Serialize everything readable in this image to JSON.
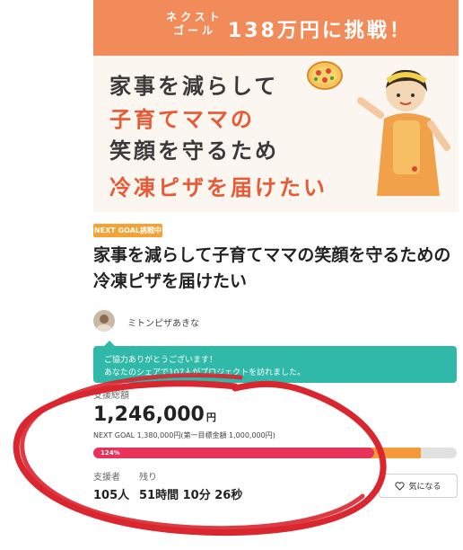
{
  "hero": {
    "next_goal_label": "ネクスト ゴール",
    "goal_text": "138万円に挑戦！",
    "line1": "家事を減らして",
    "line2": "子育てママの",
    "line3": "笑顔を守るため",
    "line4": "冷凍ピザを届けたい"
  },
  "tag": "NEXT GOAL挑戦中",
  "title": "家事を減らして子育てママの笑顔を守るための冷凍ピザを届けたい",
  "owner": {
    "name": "ミトンピザあきな"
  },
  "notice": {
    "line1": "ご協力ありがとうございます！",
    "line2": "あなたのシェアで107人がプロジェクトを訪れました。"
  },
  "funding": {
    "label": "支援総額",
    "amount": "1,246,000",
    "unit": "円",
    "next_goal_label": "NEXT GOAL",
    "next_goal_text": "1,380,000円(第一目標金額 1,000,000円)",
    "progress_label": "124%",
    "progress_percent": 124,
    "next_goal_fraction": 0.9
  },
  "stats": {
    "supporters_label": "支援者",
    "supporters_value": "105人",
    "remaining_label": "残り",
    "remaining_value": "51時間 10分 26秒"
  },
  "favorite_button": {
    "label": "気になる"
  },
  "colors": {
    "accent_teal": "#30b8a8",
    "progress_red": "#e8315b",
    "progress_orange": "#f39a3a",
    "tag_orange": "#f4a233",
    "annotation_red": "#d9262f"
  }
}
